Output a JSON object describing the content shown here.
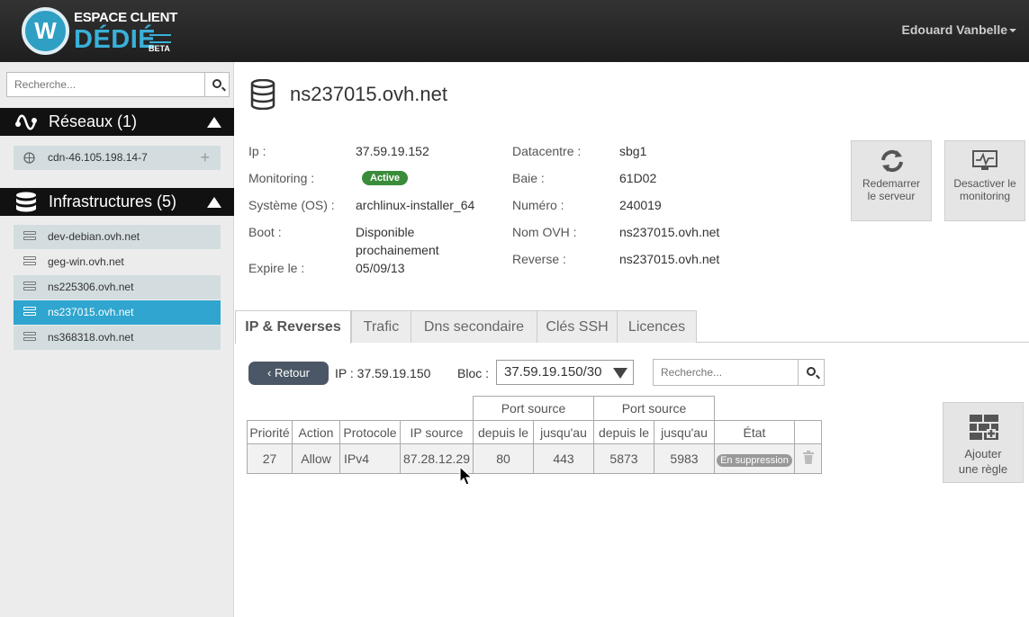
{
  "header": {
    "logo_top": "ESPACE CLIENT",
    "logo_big": "DÉDIÉ",
    "logo_beta": "BETA",
    "user": "Edouard Vanbelle"
  },
  "sidebar": {
    "search_placeholder": "Recherche...",
    "networks": {
      "title": "Réseaux (1)",
      "items": [
        "cdn-46.105.198.14-7"
      ]
    },
    "infra": {
      "title": "Infrastructures (5)",
      "items": [
        "dev-debian.ovh.net",
        "geg-win.ovh.net",
        "ns225306.ovh.net",
        "ns237015.ovh.net",
        "ns368318.ovh.net"
      ],
      "selected": "ns237015.ovh.net"
    }
  },
  "server": {
    "title": "ns237015.ovh.net",
    "left": [
      {
        "label": "Ip :",
        "value": "37.59.19.152"
      },
      {
        "label": "Monitoring :",
        "value": "Active"
      },
      {
        "label": "Système (OS) :",
        "value": "archlinux-installer_64"
      },
      {
        "label": "Boot :",
        "value": "Disponible"
      },
      {
        "label": "",
        "value": "prochainement"
      },
      {
        "label": "Expire le :",
        "value": "05/09/13"
      }
    ],
    "right": [
      {
        "label": "Datacentre :",
        "value": "sbg1"
      },
      {
        "label": "Baie :",
        "value": "61D02"
      },
      {
        "label": "Numéro :",
        "value": "240019"
      },
      {
        "label": "Nom OVH :",
        "value": "ns237015.ovh.net"
      },
      {
        "label": "Reverse :",
        "value": "ns237015.ovh.net"
      }
    ],
    "actions": {
      "reboot_1": "Redemarrer",
      "reboot_2": "le serveur",
      "mon_1": "Desactiver le",
      "mon_2": "monitoring"
    }
  },
  "tabs": [
    "IP & Reverses",
    "Trafic",
    "Dns secondaire",
    "Clés SSH",
    "Licences"
  ],
  "firewall": {
    "back": "‹ Retour",
    "ip_label": "IP : ",
    "ip_value": "37.59.19.150",
    "bloc_label": "Bloc :",
    "bloc_value": "37.59.19.150/30",
    "search_placeholder": "Recherche...",
    "group_headers": [
      "Port source",
      "Port source"
    ],
    "columns": [
      "Priorité",
      "Action",
      "Protocole",
      "IP source",
      "depuis le",
      "jusqu'au",
      "depuis le",
      "jusqu'au",
      "État",
      ""
    ],
    "rows": [
      {
        "priority": "27",
        "action": "Allow",
        "protocol": "IPv4",
        "ip_source": "87.28.12.29",
        "from1": "80",
        "to1": "443",
        "from2": "5873",
        "to2": "5983",
        "state": "En suppression"
      }
    ],
    "add_1": "Ajouter",
    "add_2": "une règle"
  }
}
